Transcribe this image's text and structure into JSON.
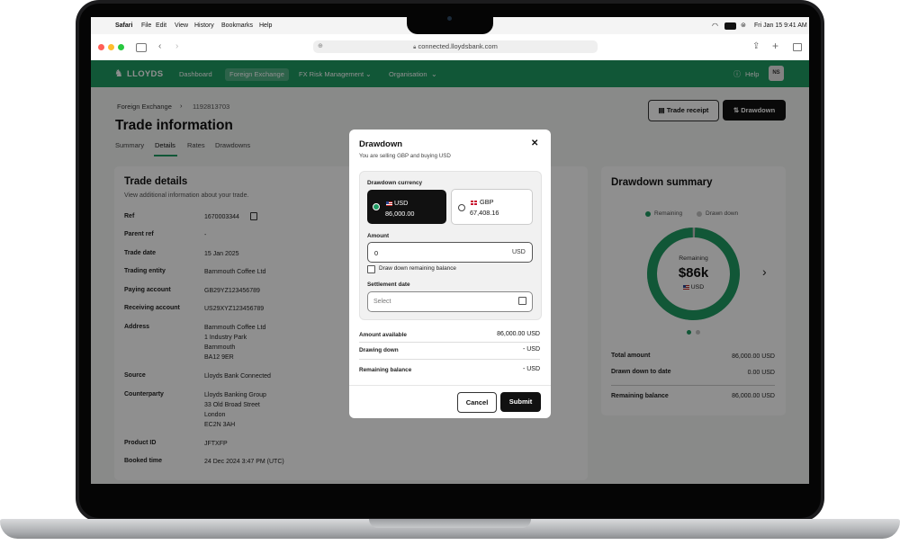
{
  "menubar": {
    "app": "Safari",
    "items": [
      "File",
      "Edit",
      "View",
      "History",
      "Bookmarks",
      "Help"
    ],
    "clock": "Fri Jan 15  9:41 AM"
  },
  "browser": {
    "url": "connected.lloydsbank.com"
  },
  "nav": {
    "brand": "LLOYDS",
    "items": [
      "Dashboard",
      "Foreign Exchange",
      "FX Risk Management",
      "Organisation"
    ],
    "active_index": 1,
    "help": "Help",
    "avatar_initials": "NS"
  },
  "page": {
    "breadcrumb": [
      "Foreign Exchange",
      "1192813703"
    ],
    "title": "Trade information",
    "tabs": [
      "Summary",
      "Details",
      "Rates",
      "Drawdowns"
    ],
    "active_tab": "Details",
    "trade_receipt_label": "Trade receipt",
    "drawdown_label": "Drawdown"
  },
  "trade_details": {
    "title": "Trade details",
    "subtitle": "View additional information about your trade.",
    "rows": [
      {
        "label": "Ref",
        "value": "1670003344"
      },
      {
        "label": "Parent ref",
        "value": "-"
      },
      {
        "label": "Trade date",
        "value": "15 Jan 2025"
      },
      {
        "label": "Trading entity",
        "value": "Barnmouth Coffee Ltd"
      },
      {
        "label": "Paying account",
        "value": "GB29YZ123456789"
      },
      {
        "label": "Receiving account",
        "value": "US29XYZ123456789"
      },
      {
        "label": "Address",
        "lines": [
          "Barnmouth Coffee Ltd",
          "1 Industry Park",
          "Barnmouth",
          "BA12 9ER"
        ]
      },
      {
        "label": "Source",
        "value": "Lloyds Bank Connected"
      },
      {
        "label": "Counterparty",
        "lines": [
          "Lloyds Banking Group",
          "33 Old Broad Street",
          "London",
          "EC2N 3AH"
        ]
      },
      {
        "label": "Product ID",
        "value": "JFTXFP"
      },
      {
        "label": "Booked time",
        "value": "24 Dec 2024   3:47 PM (UTC)"
      }
    ]
  },
  "drawdown_summary": {
    "title": "Drawdown summary",
    "legend": [
      "Remaining",
      "Drawn down"
    ],
    "donut_label": "Remaining",
    "donut_amount": "$86k",
    "donut_currency": "USD",
    "remaining_fraction": 0.99,
    "colors": {
      "remaining": "#1f9b63",
      "drawn": "#c4c4c4"
    },
    "rows": [
      {
        "label": "Total amount",
        "value": "86,000.00 USD"
      },
      {
        "label": "Drawn down to date",
        "value": "0.00 USD"
      },
      {
        "label": "Remaining balance",
        "value": "86,000.00 USD"
      }
    ]
  },
  "modal": {
    "title": "Drawdown",
    "subtitle": "You are selling GBP and buying USD",
    "currency_label": "Drawdown currency",
    "currencies": [
      {
        "code": "USD",
        "amount": "86,000.00",
        "selected": true
      },
      {
        "code": "GBP",
        "amount": "67,408.16",
        "selected": false
      }
    ],
    "amount_label": "Amount",
    "amount_value": "0",
    "amount_unit": "USD",
    "checkbox_label": "Draw down remaining balance",
    "settlement_label": "Settlement date",
    "settlement_placeholder": "Select",
    "summary": [
      {
        "label": "Amount available",
        "value": "86,000.00 USD"
      },
      {
        "label": "Drawing down",
        "value": "- USD"
      },
      {
        "label": "Remaining balance",
        "value": "- USD"
      }
    ],
    "cancel_label": "Cancel",
    "submit_label": "Submit"
  }
}
